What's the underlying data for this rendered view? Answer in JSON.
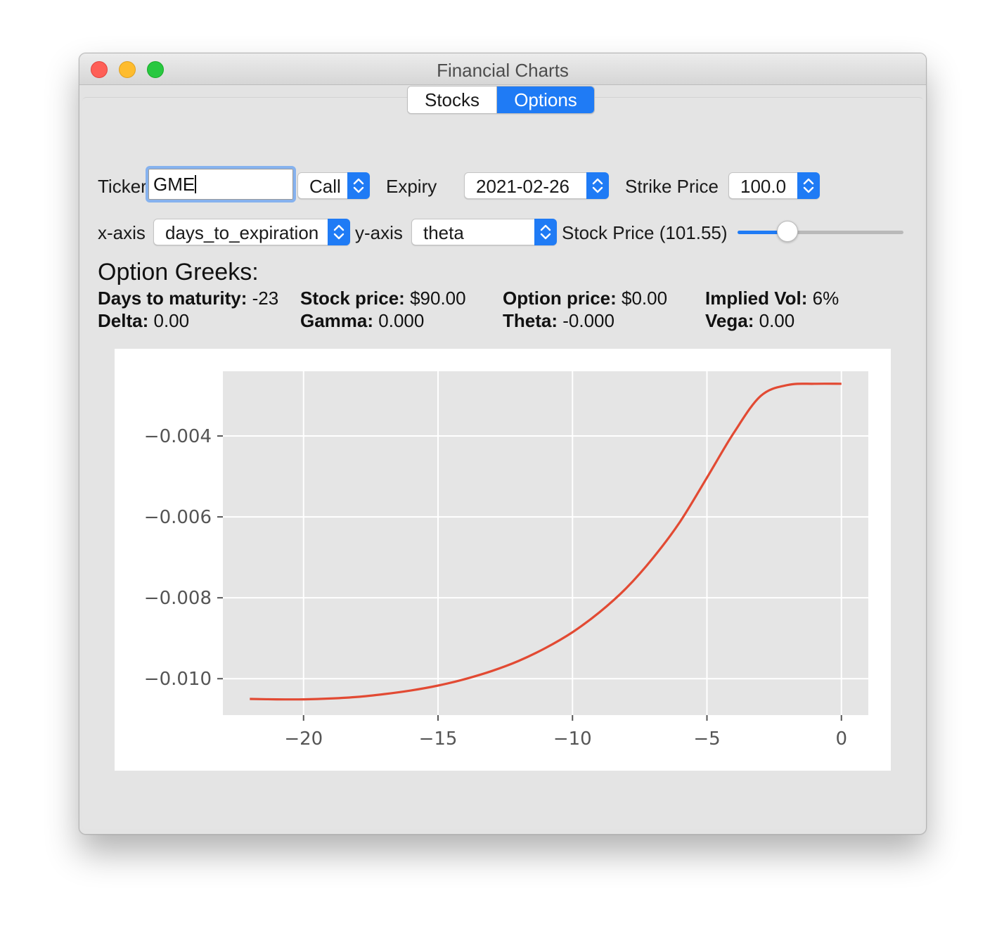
{
  "window": {
    "title": "Financial Charts"
  },
  "tabs": [
    {
      "label": "Stocks",
      "selected": false
    },
    {
      "label": "Options",
      "selected": true
    }
  ],
  "controls": {
    "ticker_label": "Ticker",
    "ticker_value": "GME",
    "option_type": "Call",
    "expiry_label": "Expiry",
    "expiry_value": "2021-02-26",
    "strike_label": "Strike Price",
    "strike_value": "100.0",
    "xaxis_label": "x-axis",
    "xaxis_value": "days_to_expiration",
    "yaxis_label": "y-axis",
    "yaxis_value": "theta",
    "stock_price_label": "Stock Price (101.55)",
    "stock_price_slider_fraction": 0.3
  },
  "greeks": {
    "title": "Option Greeks:",
    "days_label": "Days to maturity:",
    "days_value": "-23",
    "stock_label": "Stock price:",
    "stock_value": "$90.00",
    "option_label": "Option price:",
    "option_value": "$0.00",
    "iv_label": "Implied Vol:",
    "iv_value": "6%",
    "delta_label": "Delta:",
    "delta_value": "0.00",
    "gamma_label": "Gamma:",
    "gamma_value": "0.000",
    "theta_label": "Theta:",
    "theta_value": "-0.000",
    "vega_label": "Vega:",
    "vega_value": "0.00"
  },
  "colors": {
    "accent": "#1f7bf5",
    "line": "#e24a33",
    "plot_bg": "#e5e5e5",
    "grid": "#ffffff"
  },
  "chart_data": {
    "type": "line",
    "title": "",
    "xlabel": "",
    "ylabel": "",
    "xlim": [
      -23,
      1
    ],
    "ylim": [
      -0.0109,
      -0.0024
    ],
    "xticks": [
      -20,
      -15,
      -10,
      -5,
      0
    ],
    "xtick_labels": [
      "−20",
      "−15",
      "−10",
      "−5",
      "0"
    ],
    "yticks": [
      -0.004,
      -0.006,
      -0.008,
      -0.01
    ],
    "ytick_labels": [
      "−0.004",
      "−0.006",
      "−0.008",
      "−0.010"
    ],
    "grid": true,
    "series": [
      {
        "x": [
          -22,
          -21,
          -20,
          -19,
          -18,
          -17,
          -16,
          -15,
          -14,
          -13,
          -12,
          -11,
          -10,
          -9,
          -8,
          -7,
          -6,
          -5,
          -4,
          -3,
          -2,
          -1,
          0
        ],
        "y": [
          -0.0105,
          -0.01051,
          -0.01051,
          -0.01049,
          -0.01045,
          -0.01038,
          -0.01029,
          -0.01017,
          -0.01001,
          -0.00981,
          -0.00956,
          -0.00924,
          -0.00885,
          -0.00836,
          -0.00776,
          -0.00701,
          -0.00612,
          -0.00503,
          -0.00392,
          -0.00301,
          -0.00274,
          -0.00271,
          -0.00271
        ]
      }
    ]
  }
}
